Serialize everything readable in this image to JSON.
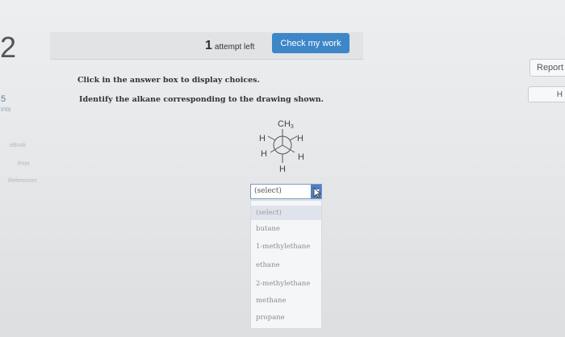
{
  "sidebar": {
    "question_number": "2",
    "points_value": "5",
    "points_label": "ints",
    "links": [
      "eBook",
      "Print",
      "References"
    ]
  },
  "topbar": {
    "attempts_number": "1",
    "attempts_text": "attempt left",
    "check_button": "Check my work"
  },
  "right_buttons": {
    "report": "Report",
    "help": "H"
  },
  "instruction": "Click in the answer box to display choices.",
  "question": "Identify the alkane corresponding to the drawing shown.",
  "newman": {
    "front_top": "CH",
    "front_top_sub": "3",
    "left_top": "H",
    "right_top": "H",
    "left_bottom": "H",
    "right_bottom": "H",
    "bottom": "H"
  },
  "answer_select": {
    "selected": "(select)",
    "options": [
      "(select)",
      "butane",
      "1-methylethane",
      "ethane",
      "2-methylethane",
      "methane",
      "propane"
    ]
  },
  "colors": {
    "accent": "#3d86c8",
    "select_border": "#7a9ac9"
  }
}
